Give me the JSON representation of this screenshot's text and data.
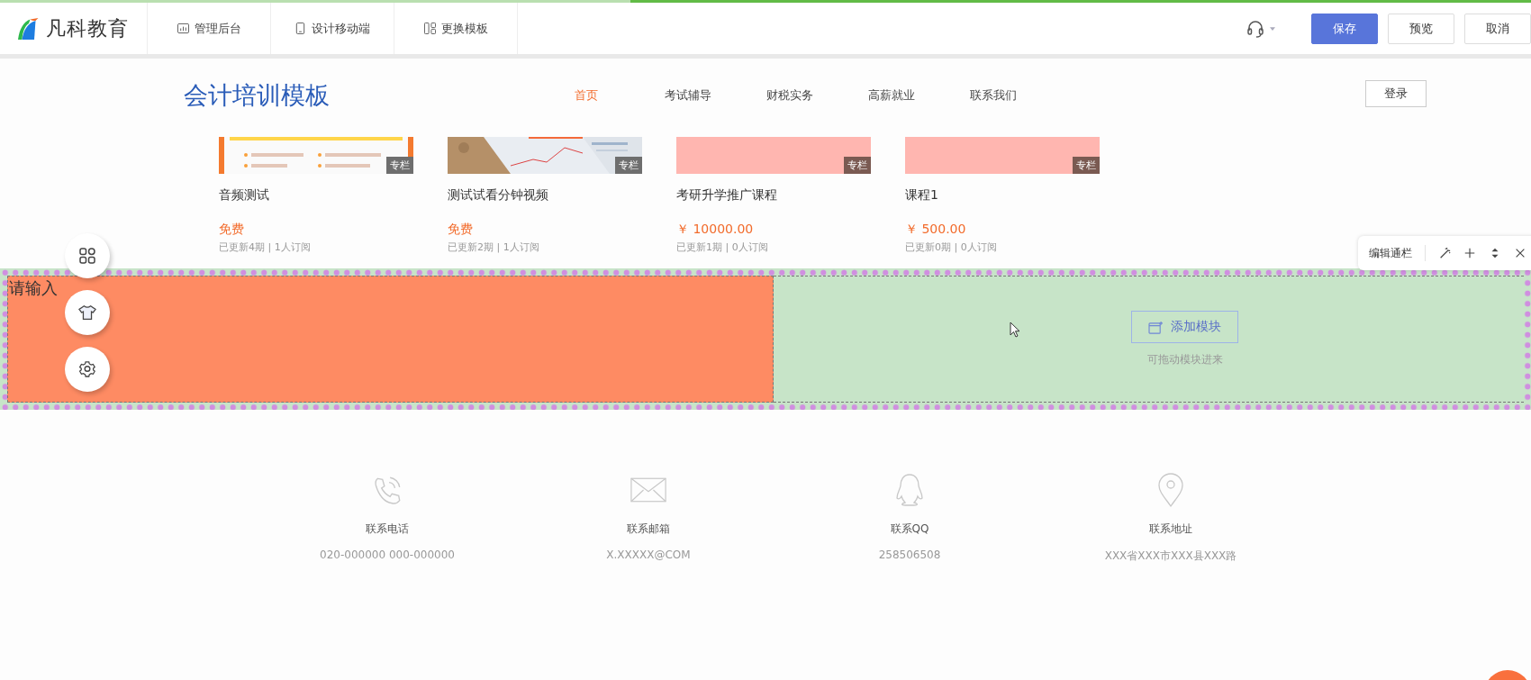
{
  "topbar": {
    "logo_text": "凡科教育",
    "tabs": [
      {
        "label": "管理后台"
      },
      {
        "label": "设计移动端"
      },
      {
        "label": "更换模板"
      }
    ],
    "buttons": [
      {
        "label": "保存",
        "kind": "primary"
      },
      {
        "label": "预览",
        "kind": "default"
      },
      {
        "label": "取消",
        "kind": "default"
      }
    ]
  },
  "site": {
    "title": "会计培训模板",
    "nav": [
      {
        "label": "首页",
        "selected": true
      },
      {
        "label": "考试辅导",
        "selected": false
      },
      {
        "label": "财税实务",
        "selected": false
      },
      {
        "label": "高薪就业",
        "selected": false
      },
      {
        "label": "联系我们",
        "selected": false
      }
    ],
    "login": "登录"
  },
  "courses": [
    {
      "kind": "picture",
      "badge": "专栏",
      "title": "音频测试",
      "price": "免费",
      "meta": "已更新4期 | 1人订阅"
    },
    {
      "kind": "picture",
      "badge": "专栏",
      "title": "测试试看分钟视频",
      "price": "免费",
      "meta": "已更新2期 | 1人订阅"
    },
    {
      "kind": "blank",
      "badge": "专栏",
      "title": "考研升学推广课程",
      "price": "￥ 10000.00",
      "meta": "已更新1期 | 0人订阅"
    },
    {
      "kind": "blank",
      "badge": "专栏",
      "title": "课程1",
      "price": "￥ 500.00",
      "meta": "已更新0期 | 0人订阅"
    }
  ],
  "band": {
    "text": "请输入",
    "add_button": "添加模块",
    "hint": "可拖动模块进来"
  },
  "edit_bar": {
    "label": "编辑通栏"
  },
  "contacts": [
    {
      "label": "联系电话",
      "value": "020-000000 000-000000"
    },
    {
      "label": "联系邮箱",
      "value": "X.XXXXX@COM"
    },
    {
      "label": "联系QQ",
      "value": "258506508"
    },
    {
      "label": "联系地址",
      "value": "XXX省XXX市XXX县XXX路"
    }
  ]
}
